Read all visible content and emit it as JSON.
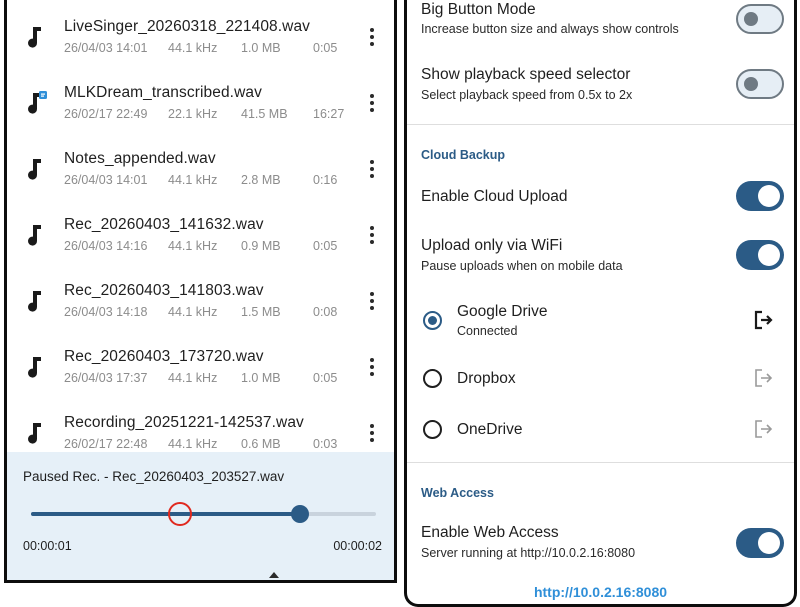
{
  "files": [
    {
      "name": "LiveSinger_20260318_221408.wav",
      "date": "26/04/03 14:01",
      "rate": "44.1 kHz",
      "size": "1.0 MB",
      "duration": "0:05",
      "icon": "music-note-icon"
    },
    {
      "name": "MLKDream_transcribed.wav",
      "date": "26/02/17 22:49",
      "rate": "22.1 kHz",
      "size": "41.5 MB",
      "duration": "16:27",
      "icon": "music-note-transcribed-icon"
    },
    {
      "name": "Notes_appended.wav",
      "date": "26/04/03 14:01",
      "rate": "44.1 kHz",
      "size": "2.8 MB",
      "duration": "0:16",
      "icon": "music-note-icon"
    },
    {
      "name": "Rec_20260403_141632.wav",
      "date": "26/04/03 14:16",
      "rate": "44.1 kHz",
      "size": "0.9 MB",
      "duration": "0:05",
      "icon": "music-note-icon"
    },
    {
      "name": "Rec_20260403_141803.wav",
      "date": "26/04/03 14:18",
      "rate": "44.1 kHz",
      "size": "1.5 MB",
      "duration": "0:08",
      "icon": "music-note-icon"
    },
    {
      "name": "Rec_20260403_173720.wav",
      "date": "26/04/03 17:37",
      "rate": "44.1 kHz",
      "size": "1.0 MB",
      "duration": "0:05",
      "icon": "music-note-icon"
    },
    {
      "name": "Recording_20251221-142537.wav",
      "date": "26/02/17 22:48",
      "rate": "44.1 kHz",
      "size": "0.6 MB",
      "duration": "0:03",
      "icon": "music-note-icon"
    }
  ],
  "player": {
    "title": "Paused Rec. - Rec_20260403_203527.wav",
    "current_time": "00:00:01",
    "total_time": "00:00:02",
    "progress": 0.78
  },
  "settings": {
    "big_button": {
      "title": "Big Button Mode",
      "subtitle": "Increase button size and always show controls",
      "enabled": false
    },
    "speed_selector": {
      "title": "Show playback speed selector",
      "subtitle": "Select playback speed from 0.5x to 2x",
      "enabled": false
    },
    "cloud_backup": {
      "header": "Cloud Backup",
      "enable_upload": {
        "title": "Enable Cloud Upload",
        "enabled": true
      },
      "wifi_only": {
        "title": "Upload only via WiFi",
        "subtitle": "Pause uploads when on mobile data",
        "enabled": true
      },
      "providers": [
        {
          "name": "Google Drive",
          "status": "Connected",
          "selected": true,
          "icon": "login-icon"
        },
        {
          "name": "Dropbox",
          "status": "",
          "selected": false,
          "icon": "login-icon"
        },
        {
          "name": "OneDrive",
          "status": "",
          "selected": false,
          "icon": "login-icon"
        }
      ]
    },
    "web_access": {
      "header": "Web Access",
      "enable": {
        "title": "Enable Web Access",
        "subtitle": "Server running at http://10.0.2.16:8080",
        "enabled": true
      },
      "link": "http://10.0.2.16:8080"
    }
  },
  "colors": {
    "accent": "#2b5b86",
    "link": "#2f8fd8",
    "player_bg": "#e6f0f8"
  }
}
